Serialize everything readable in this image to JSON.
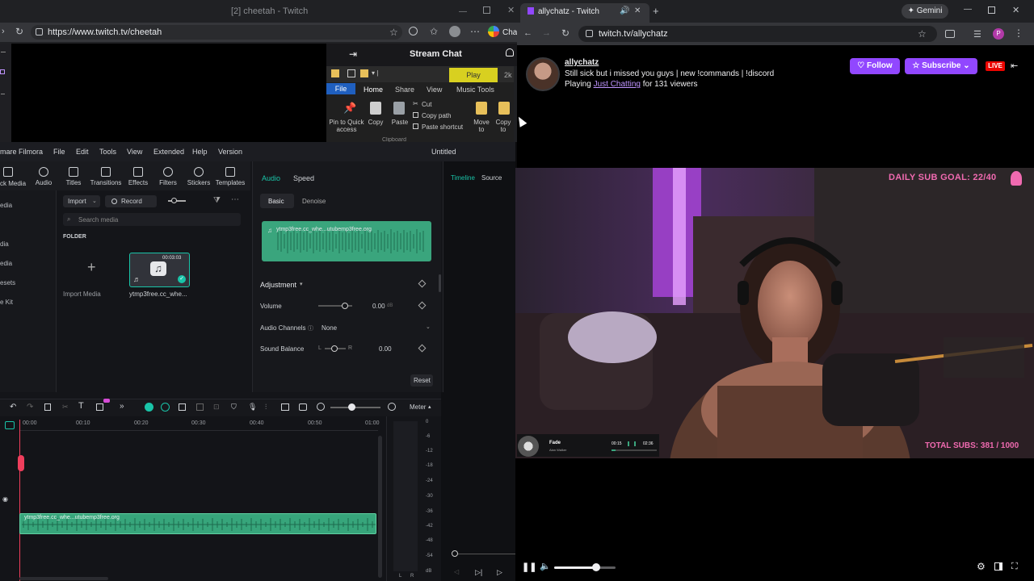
{
  "left_browser": {
    "tab_title": "[2] cheetah - Twitch",
    "url": "https://www.twitch.tv/cheetah",
    "chat_title": "Stream Chat",
    "ext_label": "Cha"
  },
  "explorer": {
    "play_tab": "Play",
    "tabs": [
      "File",
      "Home",
      "Share",
      "View",
      "Music Tools"
    ],
    "buttons": {
      "pin": "Pin to Quick access",
      "copy": "Copy",
      "paste": "Paste",
      "cut": "Cut",
      "copy_path": "Copy path",
      "paste_shortcut": "Paste shortcut",
      "move_to": "Move to",
      "copy_to": "Copy to"
    },
    "group_label": "Clipboard",
    "extra": "2k"
  },
  "filmora": {
    "app_name": "mare Filmora",
    "menu": [
      "File",
      "Edit",
      "Tools",
      "View",
      "Extended",
      "Help",
      "Version"
    ],
    "doc_title": "Untitled",
    "tools": [
      "Audio",
      "Titles",
      "Transitions",
      "Effects",
      "Filters",
      "Stickers",
      "Templates"
    ],
    "nav_first": "ck Media",
    "nav": [
      "edia",
      "dia",
      "edia",
      "esets",
      "e Kit"
    ],
    "import_label": "Import",
    "record_label": "Record",
    "search_placeholder": "Search media",
    "folder_label": "FOLDER",
    "import_media": "Import Media",
    "clip_name": "ytmp3free.cc_whe...",
    "clip_duration": "00:03:03",
    "props_tabs": [
      "Audio",
      "Speed"
    ],
    "props_subtabs": [
      "Basic",
      "Denoise"
    ],
    "waveform_name": "ytmp3free.cc_whe...utubemp3free.org",
    "adjustment": "Adjustment",
    "volume_label": "Volume",
    "volume_value": "0.00",
    "volume_unit": "dB",
    "channels_label": "Audio Channels",
    "channels_value": "None",
    "balance_label": "Sound Balance",
    "balance_l": "L",
    "balance_r": "R",
    "balance_value": "0.00",
    "reset_label": "Reset",
    "preview_tabs": [
      "Timeline",
      "Source"
    ],
    "meter_label": "Meter",
    "ruler": [
      "00:00",
      "00:10",
      "00:20",
      "00:30",
      "00:40",
      "00:50",
      "01:00"
    ],
    "meter_scale": [
      "0",
      "-6",
      "-12",
      "-18",
      "-24",
      "-30",
      "-36",
      "-42",
      "-48",
      "-54",
      "dB"
    ],
    "meter_lr": [
      "L",
      "R"
    ],
    "track_clip_name": "ytmp3free.cc_whe...utubemp3free.org"
  },
  "right_browser": {
    "tab_title": "allychatz - Twitch",
    "url": "twitch.tv/allychatz",
    "gemini": "Gemini",
    "profile_initial": "P"
  },
  "twitch": {
    "streamer": "allychatz",
    "stream_title": "Still sick but i missed you guys | new !commands | !discord",
    "playing_prefix": "Playing ",
    "category": "Just Chatting",
    "viewers_suffix": " for 131 viewers",
    "follow": "Follow",
    "subscribe": "Subscribe",
    "live": "LIVE",
    "goal_text": "DAILY SUB GOAL: 22/40",
    "subs_text": "TOTAL SUBS: 381 / 1000",
    "now_playing_title": "Fade",
    "now_playing_artist": "Alan Walker",
    "now_playing_elapsed": "00:15",
    "now_playing_total": "02:36",
    "volume_level": 0.68
  },
  "colors": {
    "twitch_purple": "#9147ff",
    "live_red": "#eb0400",
    "overlay_pink": "#f06ab0",
    "filmora_green": "#3aa57d",
    "filmora_accent": "#19c4a8"
  }
}
